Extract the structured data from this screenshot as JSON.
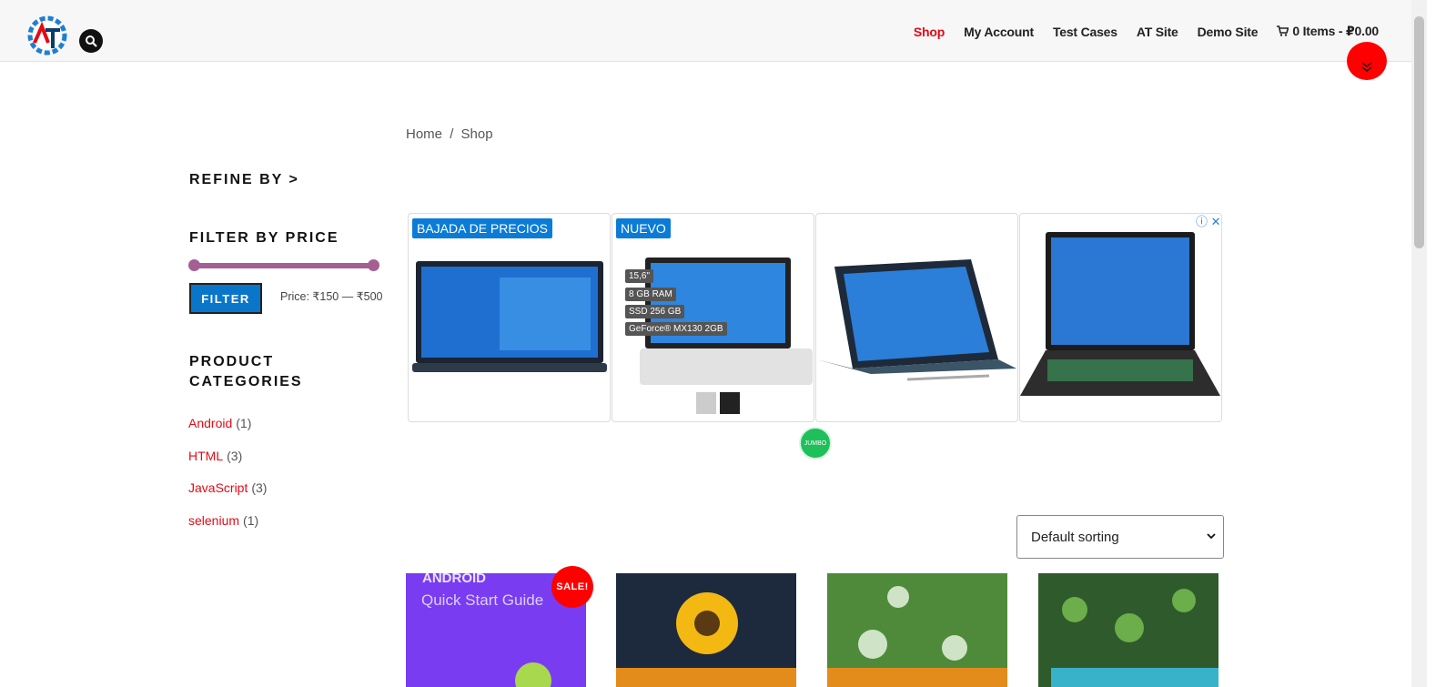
{
  "header": {
    "nav": [
      {
        "label": "Shop",
        "active": true
      },
      {
        "label": "My Account",
        "active": false
      },
      {
        "label": "Test Cases",
        "active": false
      },
      {
        "label": "AT Site",
        "active": false
      },
      {
        "label": "Demo Site",
        "active": false
      }
    ],
    "cart_label": "0 Items - ₽0.00",
    "logo_text": "AT"
  },
  "breadcrumb": {
    "home": "Home",
    "separator": "/",
    "current": "Shop"
  },
  "sidebar": {
    "refine_heading": "REFINE BY >",
    "price_heading": "FILTER BY PRICE",
    "filter_button": "FILTER",
    "price_text": "Price: ₹150 — ₹500",
    "price_range": {
      "min": 150,
      "max": 500
    },
    "categories_heading": "PRODUCT CATEGORIES",
    "categories": [
      {
        "name": "Android",
        "count": "(1)"
      },
      {
        "name": "HTML",
        "count": "(3)"
      },
      {
        "name": "JavaScript",
        "count": "(3)"
      },
      {
        "name": "selenium",
        "count": "(1)"
      }
    ]
  },
  "ad": {
    "tag1": "BAJADA DE PRECIOS",
    "tag2": "NUEVO",
    "specs": [
      "15,6\"",
      "8 GB RAM",
      "SSD 256 GB",
      "GeForce® MX130 2GB"
    ],
    "badge": "JUMBO",
    "close": "ⓘ ✕"
  },
  "sorting": {
    "selected": "Default sorting"
  },
  "products": {
    "sale_badge": "SALE!",
    "card1_title": "ANDROID",
    "card1_subtitle": "Quick Start Guide"
  },
  "colors": {
    "accent": "#e50914",
    "button_blue": "#0a76c9",
    "slider": "#a45f93",
    "sale": "#ff0000"
  }
}
